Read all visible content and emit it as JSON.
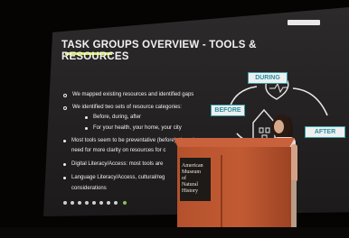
{
  "slide": {
    "title_line1": "TASK GROUPS OVERVIEW - TOOLS &",
    "title_line2": "RESOURCES",
    "bullets": [
      "We mapped existing resources and identified gaps",
      "We identified two sets of resource categories:",
      "Before, during, after",
      "For your health, your home, your city",
      "Most tools seem to be preventative (before); there is a",
      "need for more clarity on resources for c",
      "Digital Literacy/Access: most tools are",
      "Language Literacy/Access, cultural/reg",
      "considerations"
    ],
    "diagram": {
      "during": "DURING",
      "before": "BEFORE",
      "after": "AFTER"
    },
    "accent_color": "#d7e94a",
    "diagram_color": "#3b9fa8"
  },
  "lectern": {
    "logo_lines": [
      "American",
      "Museum",
      "Natural",
      "History"
    ],
    "logo_joiner": "of"
  },
  "colors": {
    "lectern": "#c25b33",
    "screen": "#242223"
  }
}
